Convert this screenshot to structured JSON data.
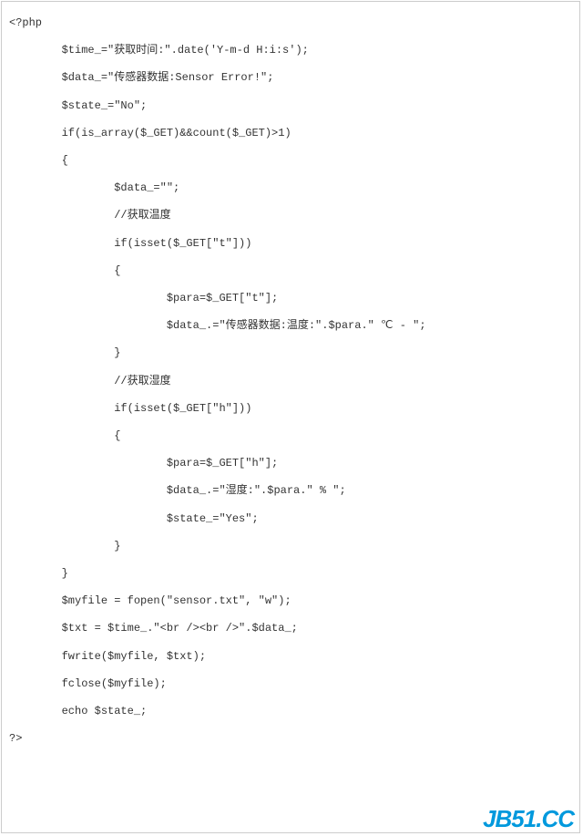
{
  "code": {
    "lines": [
      "<?php",
      "        $time_=\"获取时间:\".date('Y-m-d H:i:s');",
      "        $data_=\"传感器数据:Sensor Error!\";",
      "        $state_=\"No\";",
      "        if(is_array($_GET)&&count($_GET)>1)",
      "        {",
      "                $data_=\"\";",
      "                //获取温度",
      "                if(isset($_GET[\"t\"]))",
      "                {",
      "                        $para=$_GET[\"t\"];",
      "                        $data_.=\"传感器数据:温度:\".$para.\" ℃ - \";",
      "                }",
      "                //获取湿度",
      "                if(isset($_GET[\"h\"]))",
      "                {",
      "                        $para=$_GET[\"h\"];",
      "                        $data_.=\"湿度:\".$para.\" % \";",
      "                        $state_=\"Yes\";",
      "                }",
      "        }",
      "        $myfile = fopen(\"sensor.txt\", \"w\");",
      "        $txt = $time_.\"<br /><br />\".$data_;",
      "        fwrite($myfile, $txt);",
      "        fclose($myfile);",
      "        echo $state_;",
      "?>"
    ]
  },
  "watermark": "JB51.CC"
}
